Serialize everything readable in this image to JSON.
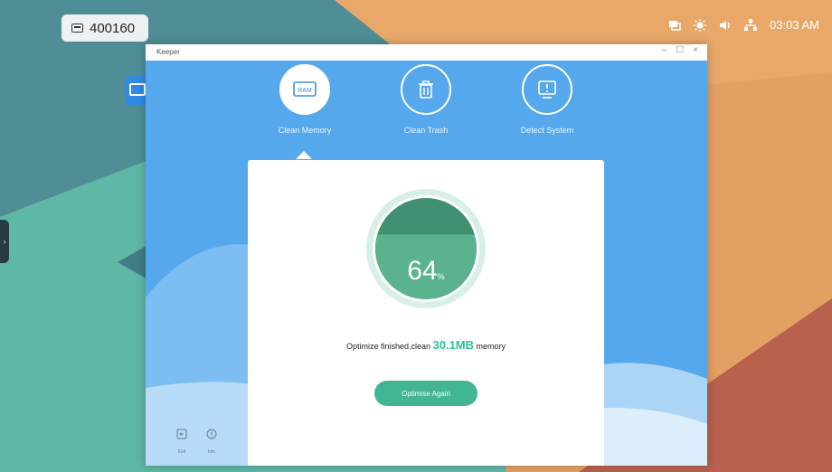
{
  "status": {
    "device_id": "400160",
    "clock": "03:03 AM"
  },
  "window": {
    "title": "Keeper",
    "controls": {
      "minimize": "–",
      "maximize": "☐",
      "close": "×"
    },
    "tabs": [
      {
        "label": "Clean Memory",
        "icon": "ram-icon",
        "active": true,
        "icon_text": "RAM"
      },
      {
        "label": "Clean Trash",
        "icon": "trash-icon",
        "active": false
      },
      {
        "label": "Detect System",
        "icon": "monitor-alert-icon",
        "active": false
      }
    ],
    "memory": {
      "percent": "64",
      "unit": "%",
      "fill_fraction": 0.64,
      "message_prefix": "Optimize finished,clean",
      "cleaned": "30.1MB",
      "message_suffix": "memory",
      "button": "Optimise Again"
    },
    "sidebar": {
      "exit": "Exit",
      "info": "Info"
    }
  },
  "colors": {
    "window_bg": "#56a8ec",
    "gauge_fill": "#5ab28f",
    "gauge_dark": "#3f8f71",
    "button": "#41b594",
    "accent_text": "#2bbf9b"
  }
}
